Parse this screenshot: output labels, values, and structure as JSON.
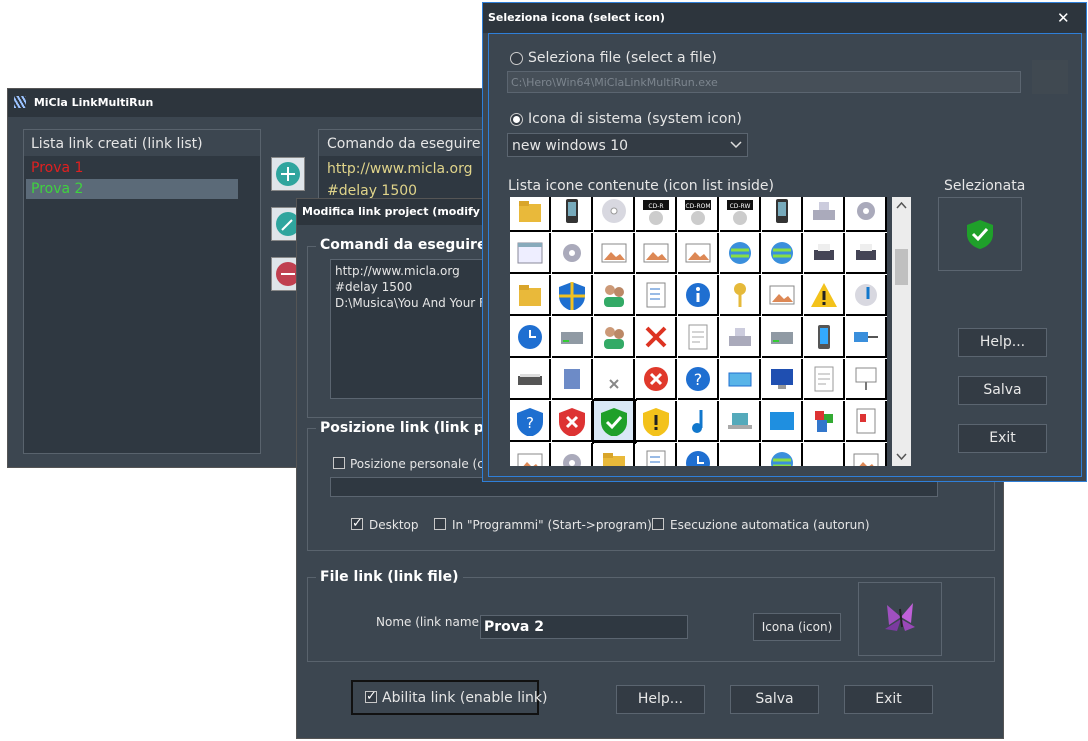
{
  "main_window": {
    "title": "MiCla LinkMultiRun",
    "list_header": "Lista link creati (link list)",
    "links": [
      {
        "label": "Prova 1",
        "color": "#e02020"
      },
      {
        "label": "Prova 2",
        "color": "#3fd23f"
      }
    ],
    "command_header": "Comando da eseguire (c",
    "commands": [
      "http://www.micla.org",
      "#delay 1500"
    ]
  },
  "modify_window": {
    "title": "Modifica link project (modify link",
    "commands_group": "Comandi da eseguire (",
    "commands_text": [
      "http://www.micla.org",
      "#delay 1500",
      "D:\\Musica\\You And Your F"
    ],
    "position_group": "Posizione link (link po",
    "personal_position": "Posizione personale (cus",
    "desktop": "Desktop",
    "programs": "In \"Programmi\" (Start->program)",
    "autorun": "Esecuzione automatica (autorun)",
    "file_group": "File link (link file)",
    "name_label": "Nome (link name)",
    "name_value": "Prova 2",
    "icon_button": "Icona (icon)",
    "enable_label": "Abilita link (enable link)",
    "help": "Help...",
    "save": "Salva",
    "exit": "Exit"
  },
  "select_icon_window": {
    "title": "Seleziona icona (select icon)",
    "close": "✕",
    "select_file": "Seleziona file (select a file)",
    "file_path": "C:\\Hero\\Win64\\MiClaLinkMultiRun.exe",
    "system_icon": "Icona di sistema (system icon)",
    "dropdown_value": "new windows 10",
    "icon_list_label": "Lista icone contenute (icon list inside)",
    "selected_label": "Selezionata",
    "help": "Help...",
    "save": "Salva",
    "exit": "Exit",
    "cd_labels": [
      "CD-R",
      "CD-ROM",
      "CD-RW"
    ]
  },
  "colors": {
    "window_bg": "#3c4650",
    "title_bg": "#2d353d",
    "accent_border": "#2f7fd8"
  }
}
